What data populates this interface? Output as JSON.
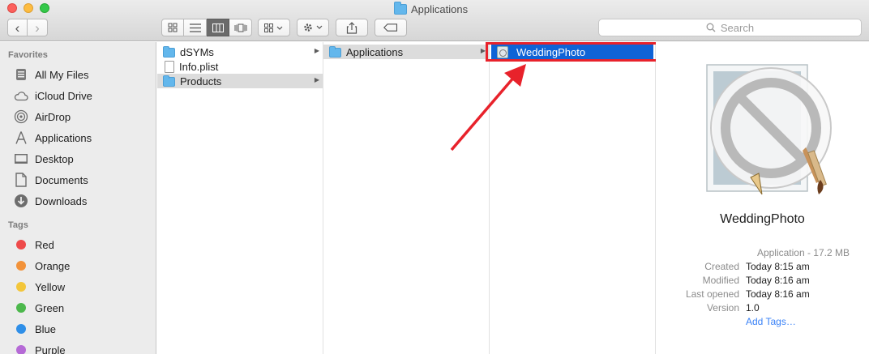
{
  "window": {
    "title": "Applications"
  },
  "toolbar": {
    "search_placeholder": "Search",
    "back_glyph": "‹",
    "forward_glyph": "›",
    "views": [
      "icon-view",
      "list-view",
      "column-view",
      "coverflow-view"
    ],
    "active_view": "column-view"
  },
  "sidebar": {
    "favorites_header": "Favorites",
    "favorites": [
      {
        "label": "All My Files",
        "icon": "all-files-icon"
      },
      {
        "label": "iCloud Drive",
        "icon": "cloud-icon"
      },
      {
        "label": "AirDrop",
        "icon": "airdrop-icon"
      },
      {
        "label": "Applications",
        "icon": "applications-icon"
      },
      {
        "label": "Desktop",
        "icon": "desktop-icon"
      },
      {
        "label": "Documents",
        "icon": "documents-icon"
      },
      {
        "label": "Downloads",
        "icon": "downloads-icon"
      }
    ],
    "tags_header": "Tags",
    "tags": [
      {
        "label": "Red",
        "color": "#ee4a4a"
      },
      {
        "label": "Orange",
        "color": "#f2923a"
      },
      {
        "label": "Yellow",
        "color": "#f3c63a"
      },
      {
        "label": "Green",
        "color": "#4cb84c"
      },
      {
        "label": "Blue",
        "color": "#2f8fe8"
      },
      {
        "label": "Purple",
        "color": "#b56ad6"
      }
    ]
  },
  "columns": {
    "col1": [
      {
        "label": "dSYMs",
        "type": "folder"
      },
      {
        "label": "Info.plist",
        "type": "file"
      },
      {
        "label": "Products",
        "type": "folder"
      }
    ],
    "col2": [
      {
        "label": "Applications",
        "type": "folder"
      }
    ],
    "col3": [
      {
        "label": "WeddingPhoto",
        "type": "app"
      }
    ]
  },
  "preview": {
    "name": "WeddingPhoto",
    "kind": "Application - 17.2 MB",
    "created_label": "Created",
    "created_value": "Today 8:15 am",
    "modified_label": "Modified",
    "modified_value": "Today 8:16 am",
    "opened_label": "Last opened",
    "opened_value": "Today 8:16 am",
    "version_label": "Version",
    "version_value": "1.0",
    "add_tags": "Add Tags…"
  },
  "annotation": {
    "highlight_color": "#e8222b"
  }
}
